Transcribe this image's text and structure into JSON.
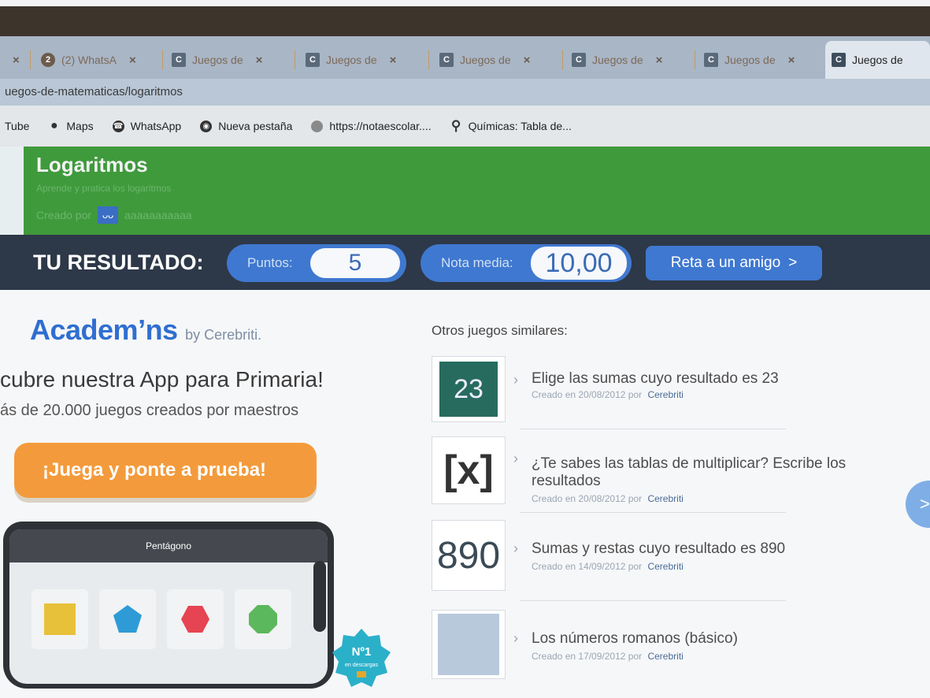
{
  "browser": {
    "tabs": [
      {
        "label": "",
        "icon": "whatsapp-icon",
        "close": "×"
      },
      {
        "label": "(2) WhatsA",
        "icon": "whatsapp-icon",
        "close": "×"
      },
      {
        "label": "Juegos de",
        "icon": "cerebriti-icon",
        "close": "×"
      },
      {
        "label": "Juegos de",
        "icon": "cerebriti-icon",
        "close": "×"
      },
      {
        "label": "Juegos de",
        "icon": "cerebriti-icon",
        "close": "×"
      },
      {
        "label": "Juegos de",
        "icon": "cerebriti-icon",
        "close": "×"
      },
      {
        "label": "Juegos de",
        "icon": "cerebriti-icon",
        "close": "×"
      },
      {
        "label": "Juegos de",
        "icon": "cerebriti-icon",
        "active": true
      }
    ],
    "favicon_letter": "C",
    "address": "uegos-de-matematicas/logaritmos",
    "bookmarks": [
      {
        "label": "Tube",
        "icon": ""
      },
      {
        "label": "Maps",
        "icon": "map-pin-icon"
      },
      {
        "label": "WhatsApp",
        "icon": "whatsapp-icon"
      },
      {
        "label": "Nueva pestaña",
        "icon": "globe-icon"
      },
      {
        "label": "https://notaescolar....",
        "icon": "site-icon"
      },
      {
        "label": "Químicas: Tabla de...",
        "icon": "search-icon"
      }
    ]
  },
  "game_header": {
    "title": "Logaritmos",
    "subtitle": "Aprende y pratica los logaritmos",
    "created_by_label": "Creado por",
    "author_avatar": "ᴗᴗ",
    "author": "aaaaaaaaaaa",
    "color": "#3f9a3c"
  },
  "result_bar": {
    "label": "TU RESULTADO:",
    "points_label": "Puntos:",
    "points_value": "5",
    "average_label": "Nota media:",
    "average_value": "10,00",
    "challenge_label": "Reta a un amigo",
    "challenge_chevron": ">",
    "accent": "#3f78d0"
  },
  "promo": {
    "logo": "Academ’ns",
    "logo_by": "by Cerebriti.",
    "headline": "cubre nuestra App para Primaria!",
    "subline": "ás de 20.000 juegos creados por maestros",
    "cta": "¡Juega y ponte a prueba!",
    "phone_title": "Pentágono",
    "badge_text": "Nº1",
    "badge_sub": "en descargas",
    "cta_color": "#f39b3c"
  },
  "similar": {
    "heading": "Otros juegos similares:",
    "by_label": "por",
    "games": [
      {
        "thumb": "23",
        "title": "Elige las sumas cuyo resultado es 23",
        "created": "Creado en 20/08/2012",
        "author": "Cerebriti"
      },
      {
        "thumb": "[x]",
        "title": "¿Te sabes las tablas de multiplicar? Escribe los resultados",
        "created": "Creado en 20/08/2012",
        "author": "Cerebriti"
      },
      {
        "thumb": "890",
        "title": "Sumas y restas cuyo resultado es 890",
        "created": "Creado en 14/09/2012",
        "author": "Cerebriti"
      },
      {
        "thumb": "",
        "title": "Los números romanos (básico)",
        "created": "Creado en 17/09/2012",
        "author": "Cerebriti"
      }
    ],
    "next": ">"
  }
}
